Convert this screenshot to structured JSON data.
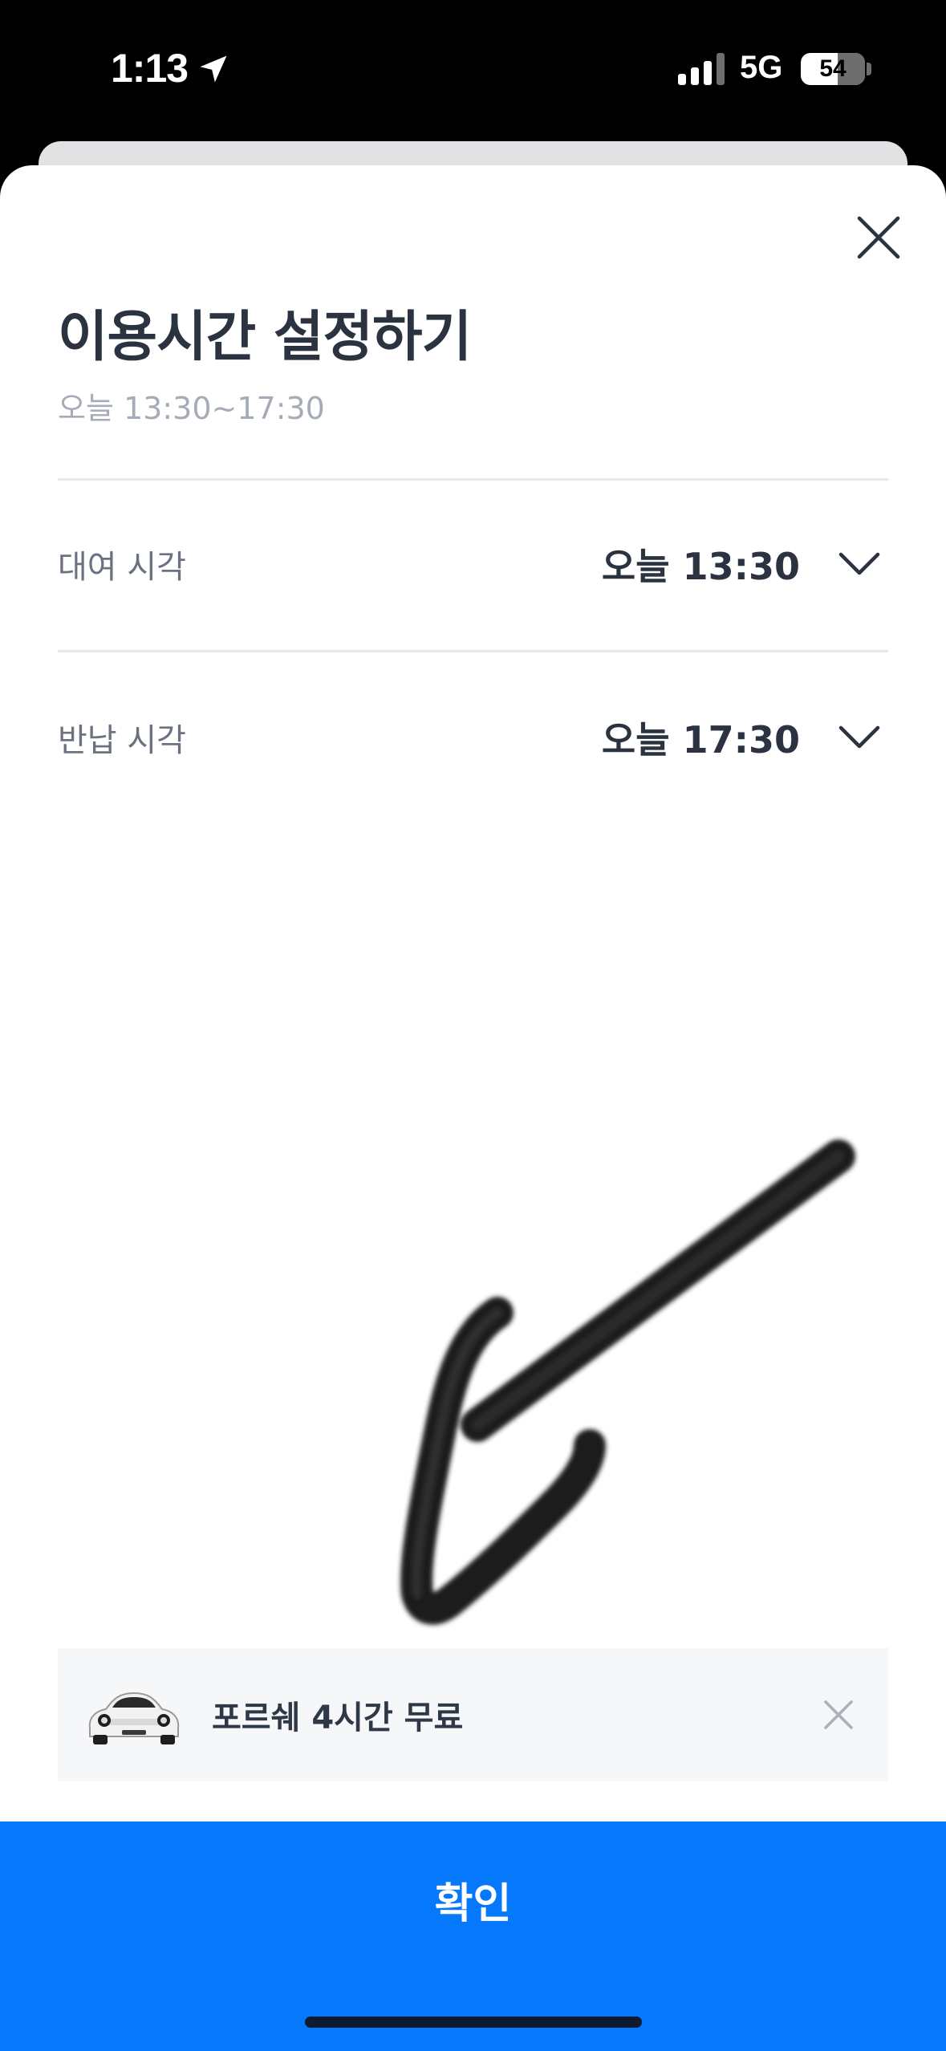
{
  "status_bar": {
    "time": "1:13",
    "network": "5G",
    "battery_level": "54",
    "icons": [
      "location-arrow-icon",
      "signal-icon",
      "battery-icon"
    ]
  },
  "sheet": {
    "title": "이용시간 설정하기",
    "subtitle": "오늘 13:30~17:30",
    "close_icon": "close-icon",
    "rows": [
      {
        "label": "대여 시각",
        "value": "오늘 13:30",
        "icon": "chevron-down-icon"
      },
      {
        "label": "반납 시각",
        "value": "오늘 17:30",
        "icon": "chevron-down-icon"
      }
    ]
  },
  "promo": {
    "text": "포르쉐 4시간 무료",
    "image": "car-image",
    "close_icon": "close-icon"
  },
  "confirm": {
    "label": "확인"
  },
  "colors": {
    "primary": "#0578fb",
    "title": "#2b3340",
    "subtitle": "#a5acb8",
    "label": "#6a7282",
    "divider": "#e6e8ee",
    "banner_bg": "#f6f7f9"
  }
}
